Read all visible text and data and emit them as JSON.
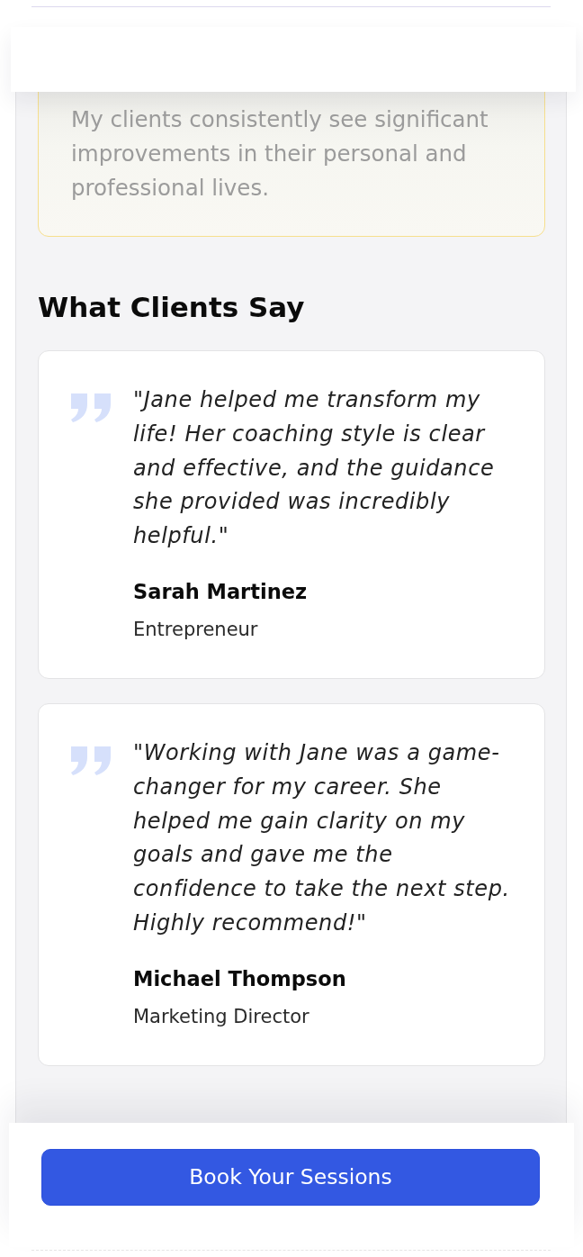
{
  "intro_box": {
    "text": "My clients consistently see significant improvements in their personal and professional lives."
  },
  "section_title": "What Clients Say",
  "testimonials": [
    {
      "quote": "\"Jane helped me transform my life! Her coaching style is clear and effective, and the guidance she provided was incredibly helpful.\"",
      "name": "Sarah Martinez",
      "role": "Entrepreneur"
    },
    {
      "quote": "\"Working with Jane was a game-changer for my career. She helped me gain clarity on my goals and gave me the confidence to take the next step. Highly recommend!\"",
      "name": "Michael Thompson",
      "role": "Marketing Director"
    }
  ],
  "footer": {
    "button": "Book Your Sessions"
  }
}
